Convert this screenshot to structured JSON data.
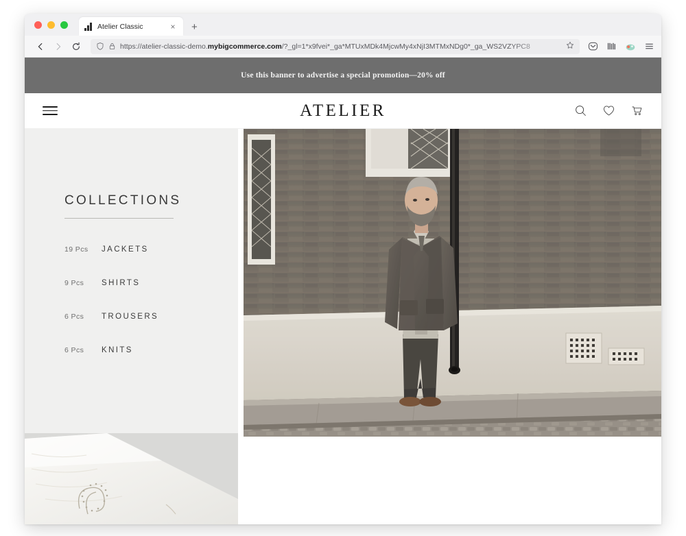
{
  "browser": {
    "tab": {
      "title": "Atelier Classic",
      "favicon": "bar-chart-favicon",
      "close_label": "×"
    },
    "new_tab_label": "+",
    "nav": {
      "back_label": "←",
      "forward_label": "→",
      "reload_label": "↻"
    },
    "url": {
      "scheme": "https://",
      "subdomain": "atelier-classic-demo.",
      "domain": "mybigcommerce.com",
      "path": "/?_gl=1*x9fvei*_ga*MTUxMDk4MjcwMy4xNjI3MTMxNDg0*_ga_WS2VZYPC8",
      "shield_icon": "shield-icon",
      "lock_icon": "lock-icon",
      "bookmark_icon": "star-icon"
    },
    "toolbar_icons": [
      "pocket-icon",
      "library-icon",
      "account-avatar-icon",
      "app-menu-icon"
    ],
    "window_controls": [
      "close",
      "minimize",
      "maximize"
    ]
  },
  "page": {
    "promo_banner": {
      "text": "Use this banner to advertise a special promotion—20% off",
      "background": "#6e6e6e"
    },
    "header": {
      "menu_icon": "hamburger-menu-icon",
      "logo": "ATELIER",
      "icons": [
        {
          "name": "search-icon"
        },
        {
          "name": "wishlist-heart-icon"
        },
        {
          "name": "shopping-cart-icon"
        }
      ]
    },
    "collections": {
      "heading": "COLLECTIONS",
      "items": [
        {
          "count": "19 Pcs",
          "name": "JACKETS"
        },
        {
          "count": "9 Pcs",
          "name": "SHIRTS"
        },
        {
          "count": "6 Pcs",
          "name": "TROUSERS"
        },
        {
          "count": "6 Pcs",
          "name": "KNITS"
        }
      ],
      "background": "#f0f0ef"
    },
    "hero_image": {
      "alt": "Man in grey jacket leaning against brick wall on cobbled street",
      "accent": "#6f675e"
    },
    "fabric_image": {
      "alt": "Close-up of cream embroidered fabric",
      "accent": "#f2efe9"
    }
  }
}
